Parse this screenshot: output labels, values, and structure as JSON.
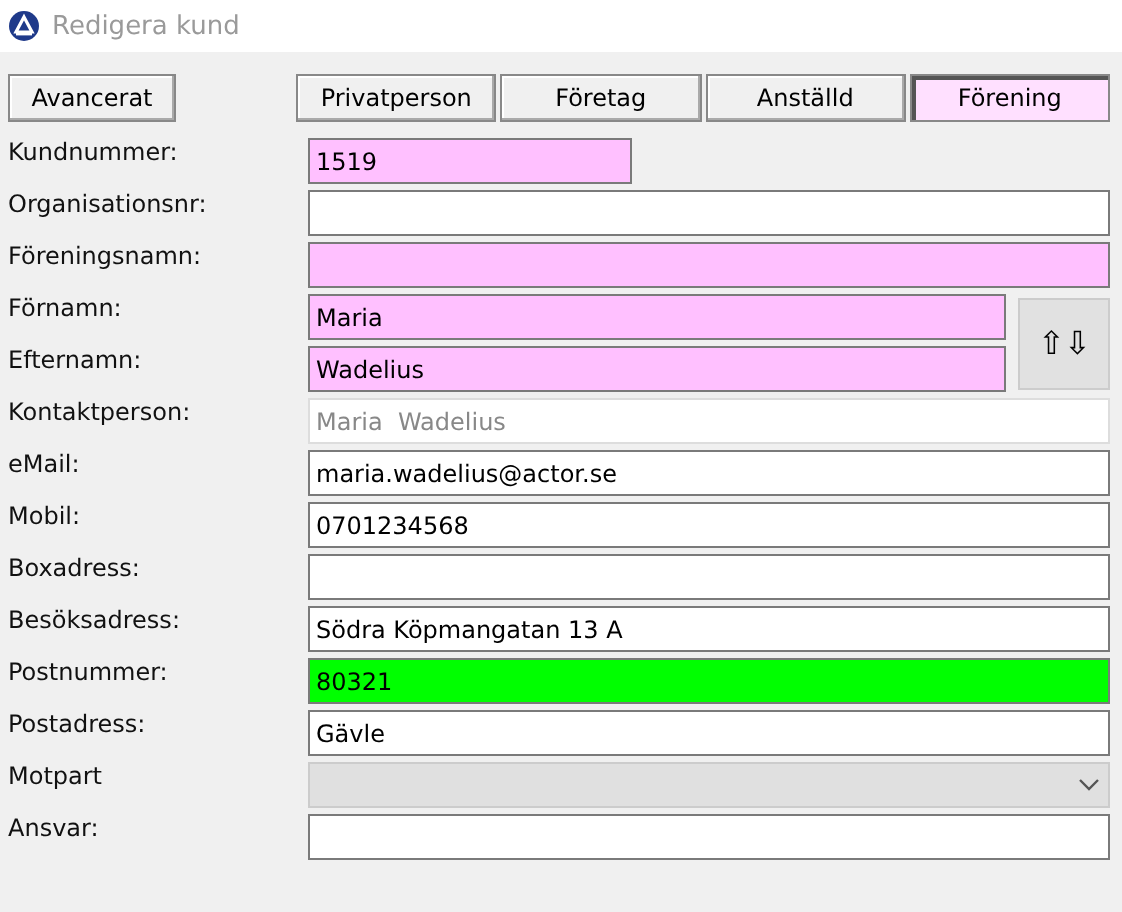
{
  "window": {
    "title": "Redigera kund"
  },
  "advanced_button": "Avancerat",
  "tabs": [
    {
      "label": "Privatperson",
      "selected": false
    },
    {
      "label": "Företag",
      "selected": false
    },
    {
      "label": "Anställd",
      "selected": false
    },
    {
      "label": "Förening",
      "selected": true
    }
  ],
  "customer_number": {
    "label": "Kundnummer:",
    "value": "1519",
    "color": "#ffc0ff"
  },
  "fields_top": [
    {
      "label": "Organisationsnr:",
      "kind": "text",
      "color": "#ffffff"
    },
    {
      "label": "Föreningsnamn:",
      "kind": "text",
      "color": "#ffc0ff"
    }
  ],
  "name_group": {
    "swap_button": "⇧⇩",
    "fields": [
      {
        "label": "Förnamn:",
        "kind": "text",
        "value": "Maria",
        "color": "#ffc0ff"
      },
      {
        "label": "Efternamn:",
        "kind": "text",
        "value": "Wadelius",
        "color": "#ffc0ff"
      }
    ]
  },
  "fields": [
    {
      "label": "Kontaktperson:",
      "kind": "readonly",
      "value": "Maria  Wadelius",
      "color": "#ffffff"
    },
    {
      "label": "eMail:",
      "kind": "text",
      "value": "maria.wadelius@actor.se",
      "color": "#ffffff"
    },
    {
      "label": "Mobil:",
      "kind": "text",
      "value": "0701234568",
      "color": "#ffffff"
    },
    {
      "label": "Boxadress:",
      "kind": "text",
      "color": "#ffffff"
    },
    {
      "label": "Besöksadress:",
      "kind": "text",
      "value": "Södra Köpmangatan 13 A",
      "color": "#ffffff"
    },
    {
      "label": "Postnummer:",
      "kind": "text",
      "value": "80321",
      "color": "#00ff00"
    },
    {
      "label": "Postadress:",
      "kind": "text",
      "value": "Gävle",
      "color": "#ffffff"
    },
    {
      "label": "Motpart",
      "kind": "select",
      "color": "#e0e0e0"
    },
    {
      "label": "Ansvar:",
      "kind": "text",
      "color": "#ffffff"
    }
  ]
}
